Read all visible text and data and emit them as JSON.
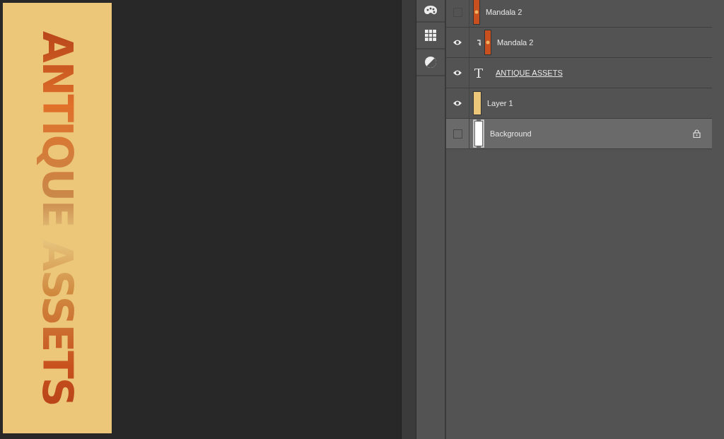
{
  "canvas": {
    "text": "ANTIQUE ASSETS"
  },
  "tools": [
    {
      "kind": "palette"
    },
    {
      "kind": "grid"
    },
    {
      "kind": "contrast"
    }
  ],
  "layers": [
    {
      "name": "Mandala 2",
      "kind": "image",
      "visible": false,
      "selected": false,
      "clipped": false,
      "locked": false
    },
    {
      "name": "Mandala 2",
      "kind": "image",
      "visible": true,
      "selected": false,
      "clipped": true,
      "locked": false
    },
    {
      "name": "ANTIQUE ASSETS",
      "kind": "text",
      "visible": true,
      "selected": false,
      "clipped": false,
      "locked": false
    },
    {
      "name": "Layer 1",
      "kind": "fill",
      "visible": true,
      "selected": false,
      "clipped": false,
      "locked": false
    },
    {
      "name": "Background",
      "kind": "background",
      "visible": false,
      "selected": true,
      "clipped": false,
      "locked": true
    }
  ]
}
